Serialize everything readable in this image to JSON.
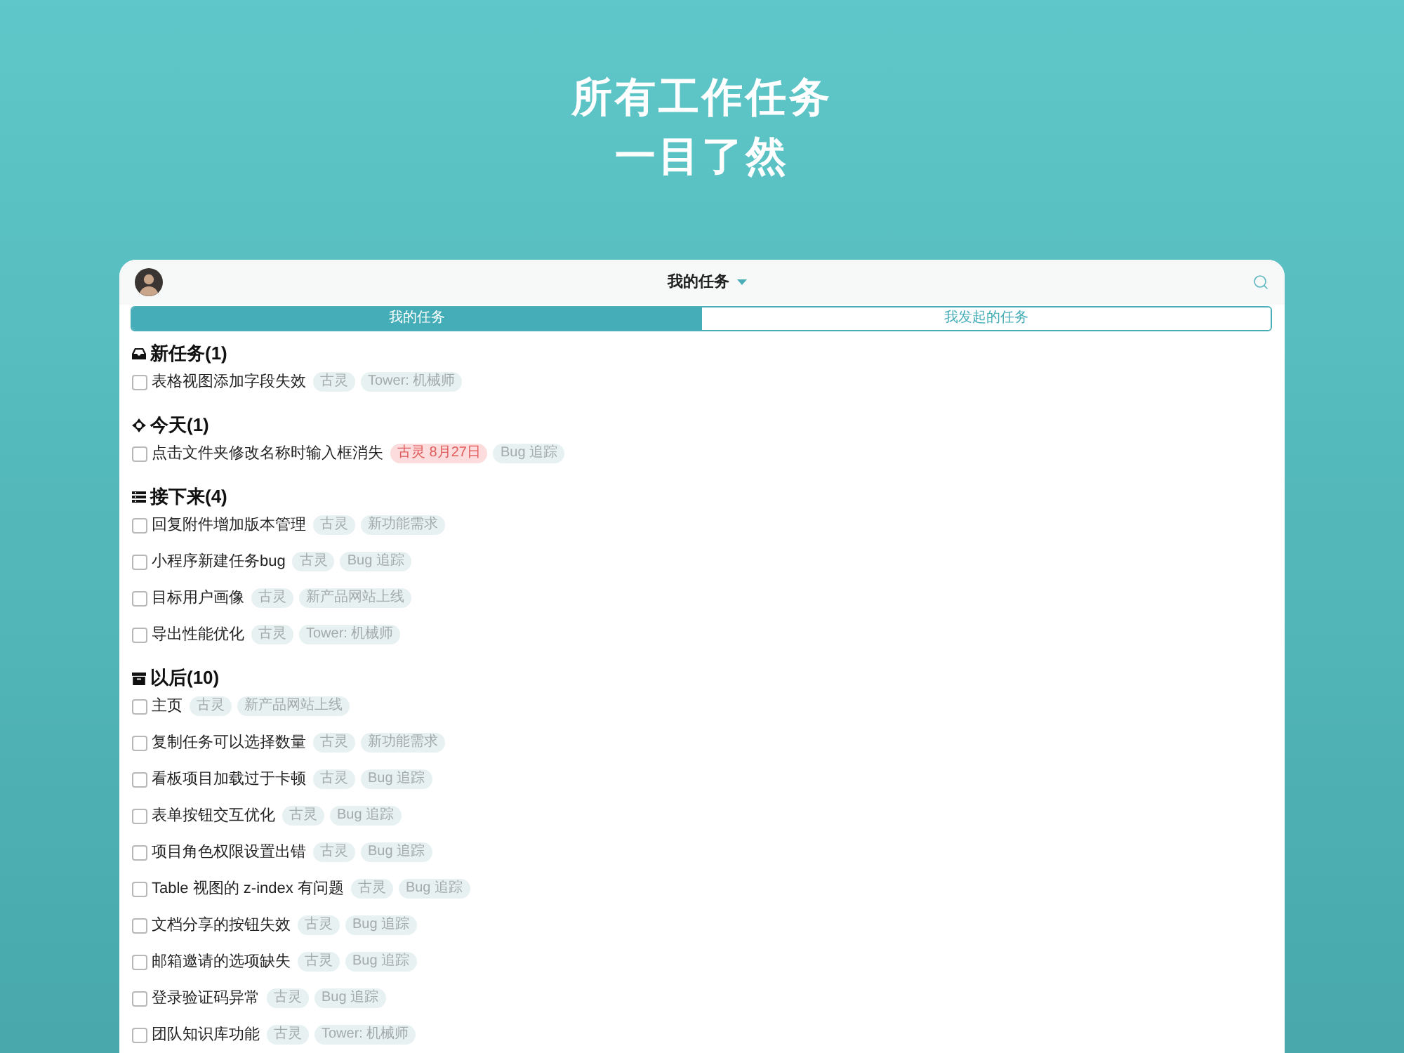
{
  "hero": {
    "lines": [
      "所有工作任务",
      "一目了然"
    ]
  },
  "app": {
    "title": "我的任务",
    "segments": [
      {
        "label": "我的任务",
        "selected": true
      },
      {
        "label": "我发起的任务",
        "selected": false
      }
    ],
    "sections": [
      {
        "kind": "inbox",
        "title": "新任务(1)",
        "tasks": [
          {
            "title": "表格视图添加字段失效",
            "checked": false,
            "tags": [
              {
                "text": "古灵",
                "kind": "normal"
              },
              {
                "text": "Tower: 机械师",
                "kind": "normal"
              }
            ]
          }
        ]
      },
      {
        "kind": "today",
        "title": "今天(1)",
        "tasks": [
          {
            "title": "点击文件夹修改名称时输入框消失",
            "checked": false,
            "tags": [
              {
                "text": "古灵 8月27日",
                "kind": "overdue"
              },
              {
                "text": "Bug 追踪",
                "kind": "normal"
              }
            ]
          }
        ]
      },
      {
        "kind": "upcoming",
        "title": "接下来(4)",
        "tasks": [
          {
            "title": "回复附件增加版本管理",
            "checked": false,
            "tags": [
              {
                "text": "古灵",
                "kind": "normal"
              },
              {
                "text": "新功能需求",
                "kind": "normal"
              }
            ]
          },
          {
            "title": "小程序新建任务bug",
            "checked": false,
            "tags": [
              {
                "text": "古灵",
                "kind": "normal"
              },
              {
                "text": "Bug 追踪",
                "kind": "normal"
              }
            ]
          },
          {
            "title": "目标用户画像",
            "checked": false,
            "tags": [
              {
                "text": "古灵",
                "kind": "normal"
              },
              {
                "text": "新产品网站上线",
                "kind": "normal"
              }
            ]
          },
          {
            "title": "导出性能优化",
            "checked": false,
            "tags": [
              {
                "text": "古灵",
                "kind": "normal"
              },
              {
                "text": "Tower: 机械师",
                "kind": "normal"
              }
            ]
          }
        ]
      },
      {
        "kind": "later",
        "title": "以后(10)",
        "tasks": [
          {
            "title": "主页",
            "checked": false,
            "tags": [
              {
                "text": "古灵",
                "kind": "normal"
              },
              {
                "text": "新产品网站上线",
                "kind": "normal"
              }
            ]
          },
          {
            "title": "复制任务可以选择数量",
            "checked": false,
            "tags": [
              {
                "text": "古灵",
                "kind": "normal"
              },
              {
                "text": "新功能需求",
                "kind": "normal"
              }
            ]
          },
          {
            "title": "看板项目加载过于卡顿",
            "checked": false,
            "tags": [
              {
                "text": "古灵",
                "kind": "normal"
              },
              {
                "text": "Bug 追踪",
                "kind": "normal"
              }
            ]
          },
          {
            "title": "表单按钮交互优化",
            "checked": false,
            "tags": [
              {
                "text": "古灵",
                "kind": "normal"
              },
              {
                "text": "Bug 追踪",
                "kind": "normal"
              }
            ]
          },
          {
            "title": "项目角色权限设置出错",
            "checked": false,
            "tags": [
              {
                "text": "古灵",
                "kind": "normal"
              },
              {
                "text": "Bug 追踪",
                "kind": "normal"
              }
            ]
          },
          {
            "title": "Table 视图的 z-index 有问题",
            "checked": false,
            "tags": [
              {
                "text": "古灵",
                "kind": "normal"
              },
              {
                "text": "Bug 追踪",
                "kind": "normal"
              }
            ]
          },
          {
            "title": "文档分享的按钮失效",
            "checked": false,
            "tags": [
              {
                "text": "古灵",
                "kind": "normal"
              },
              {
                "text": "Bug 追踪",
                "kind": "normal"
              }
            ]
          },
          {
            "title": "邮箱邀请的选项缺失",
            "checked": false,
            "tags": [
              {
                "text": "古灵",
                "kind": "normal"
              },
              {
                "text": "Bug 追踪",
                "kind": "normal"
              }
            ]
          },
          {
            "title": "登录验证码异常",
            "checked": false,
            "tags": [
              {
                "text": "古灵",
                "kind": "normal"
              },
              {
                "text": "Bug 追踪",
                "kind": "normal"
              }
            ]
          },
          {
            "title": "团队知识库功能",
            "checked": false,
            "tags": [
              {
                "text": "古灵",
                "kind": "normal"
              },
              {
                "text": "Tower: 机械师",
                "kind": "normal"
              }
            ]
          }
        ]
      }
    ]
  }
}
